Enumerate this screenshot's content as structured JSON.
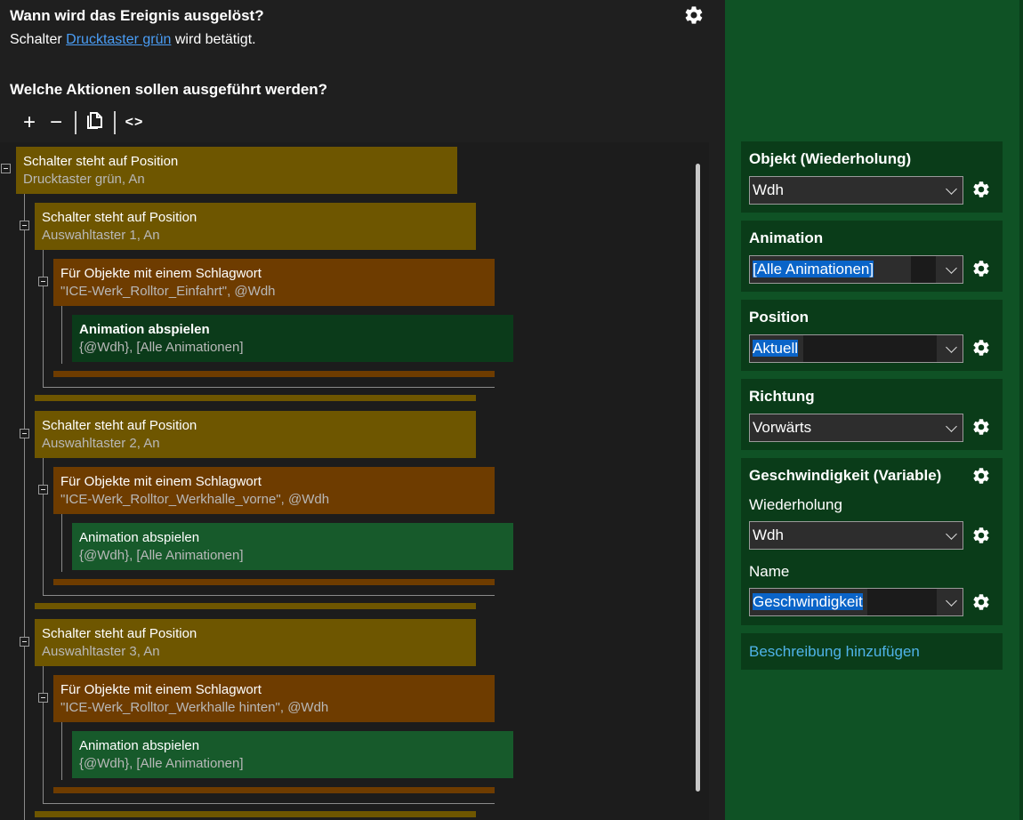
{
  "event": {
    "question": "Wann wird das Ereignis ausgelöst?",
    "trigger_prefix": "Schalter",
    "trigger_link": "Drucktaster grün",
    "trigger_suffix": "wird betätigt."
  },
  "actions": {
    "question": "Welche Aktionen sollen ausgeführt werden?",
    "toolbar": {
      "add": "+",
      "remove": "−",
      "copy": "⧉",
      "code": "<>"
    }
  },
  "tree": {
    "root": {
      "title": "Schalter steht auf Position",
      "sub": "Drucktaster grün, An"
    },
    "groups": [
      {
        "switch": {
          "title": "Schalter steht auf Position",
          "sub": "Auswahltaster 1, An"
        },
        "foreach": {
          "title": "Für Objekte mit einem Schlagwort",
          "sub": "\"ICE-Werk_Rolltor_Einfahrt\", @Wdh"
        },
        "anim": {
          "title": "Animation abspielen",
          "sub": "{@Wdh}, [Alle Animationen]"
        }
      },
      {
        "switch": {
          "title": "Schalter steht auf Position",
          "sub": "Auswahltaster 2, An"
        },
        "foreach": {
          "title": "Für Objekte mit einem Schlagwort",
          "sub": "\"ICE-Werk_Rolltor_Werkhalle_vorne\", @Wdh"
        },
        "anim": {
          "title": "Animation abspielen",
          "sub": "{@Wdh}, [Alle Animationen]"
        }
      },
      {
        "switch": {
          "title": "Schalter steht auf Position",
          "sub": "Auswahltaster 3, An"
        },
        "foreach": {
          "title": "Für Objekte mit einem Schlagwort",
          "sub": "\"ICE-Werk_Rolltor_Werkhalle hinten\", @Wdh"
        },
        "anim": {
          "title": "Animation abspielen",
          "sub": "{@Wdh}, [Alle Animationen]"
        }
      }
    ]
  },
  "props": {
    "objekt": {
      "label": "Objekt (Wiederholung)",
      "value": "Wdh"
    },
    "animation": {
      "label": "Animation",
      "value": "[Alle Animationen]"
    },
    "position": {
      "label": "Position",
      "value": "Aktuell"
    },
    "richtung": {
      "label": "Richtung",
      "value": "Vorwärts"
    },
    "geschwindigkeit": {
      "label": "Geschwindigkeit (Variable)",
      "wdh_label": "Wiederholung",
      "wdh_value": "Wdh",
      "name_label": "Name",
      "name_value": "Geschwindigkeit"
    },
    "add_description": "Beschreibung hinzufügen"
  },
  "colors": {
    "condition": "#6e5600",
    "foreach": "#6e3c00",
    "animation": "#175a2b",
    "animation_selected": "#0b3b1a",
    "panel": "#0f5225",
    "card": "#0a3c19",
    "link": "#4a9df5"
  }
}
